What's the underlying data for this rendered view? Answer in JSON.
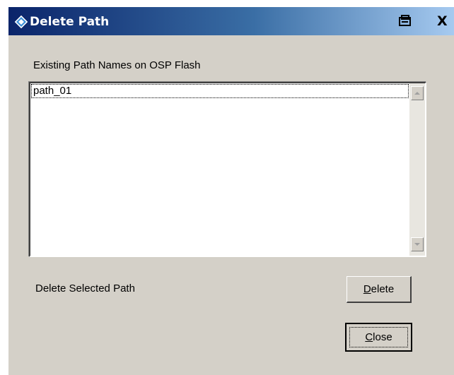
{
  "window": {
    "title": "Delete Path",
    "icons": {
      "app": "diamond-app-icon",
      "pin": "pin-icon",
      "close": "close-icon"
    },
    "close_glyph": "X"
  },
  "existing_paths": {
    "label": "Existing Path Names on OSP Flash",
    "items": [
      "path_01"
    ],
    "selected_index": 0
  },
  "delete_section": {
    "label": "Delete Selected Path",
    "delete_button": {
      "mnemonic": "D",
      "rest": "elete"
    }
  },
  "close_button": {
    "mnemonic": "C",
    "rest": "lose"
  },
  "colors": {
    "titlebar_start": "#0a246a",
    "titlebar_end": "#a6caf0",
    "dialog_bg": "#d4d0c8"
  }
}
